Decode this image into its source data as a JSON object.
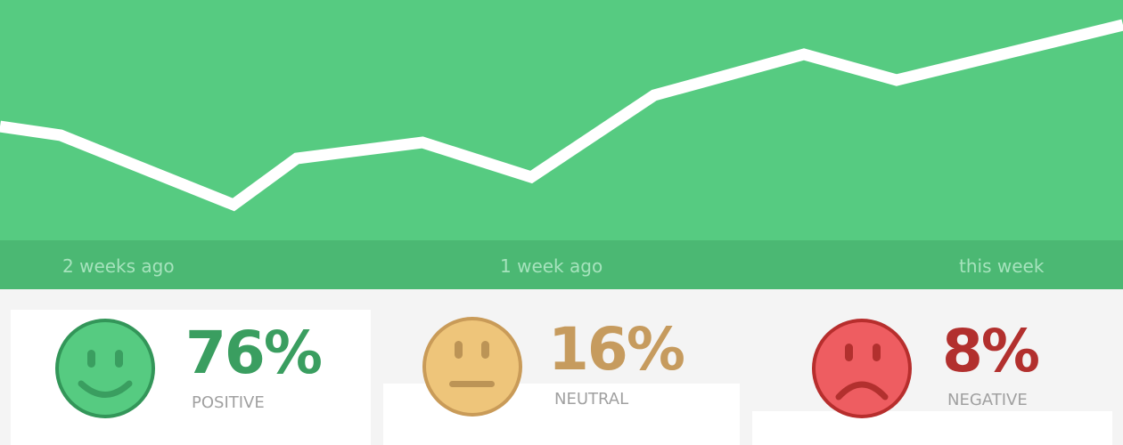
{
  "colors": {
    "chart_bg": "#56cb81",
    "timeline_bg": "#4bb873",
    "positive": "#3a9e60",
    "neutral": "#c69b5e",
    "negative": "#b2302e"
  },
  "timeline": {
    "labels": [
      "2 weeks ago",
      "1 week ago",
      "this week"
    ]
  },
  "sentiment": {
    "positive": {
      "value": "76%",
      "label": "POSITIVE",
      "icon": "smiley-face-icon"
    },
    "neutral": {
      "value": "16%",
      "label": "NEUTRAL",
      "icon": "neutral-face-icon"
    },
    "negative": {
      "value": "8%",
      "label": "NEGATIVE",
      "icon": "sad-face-icon"
    }
  }
}
